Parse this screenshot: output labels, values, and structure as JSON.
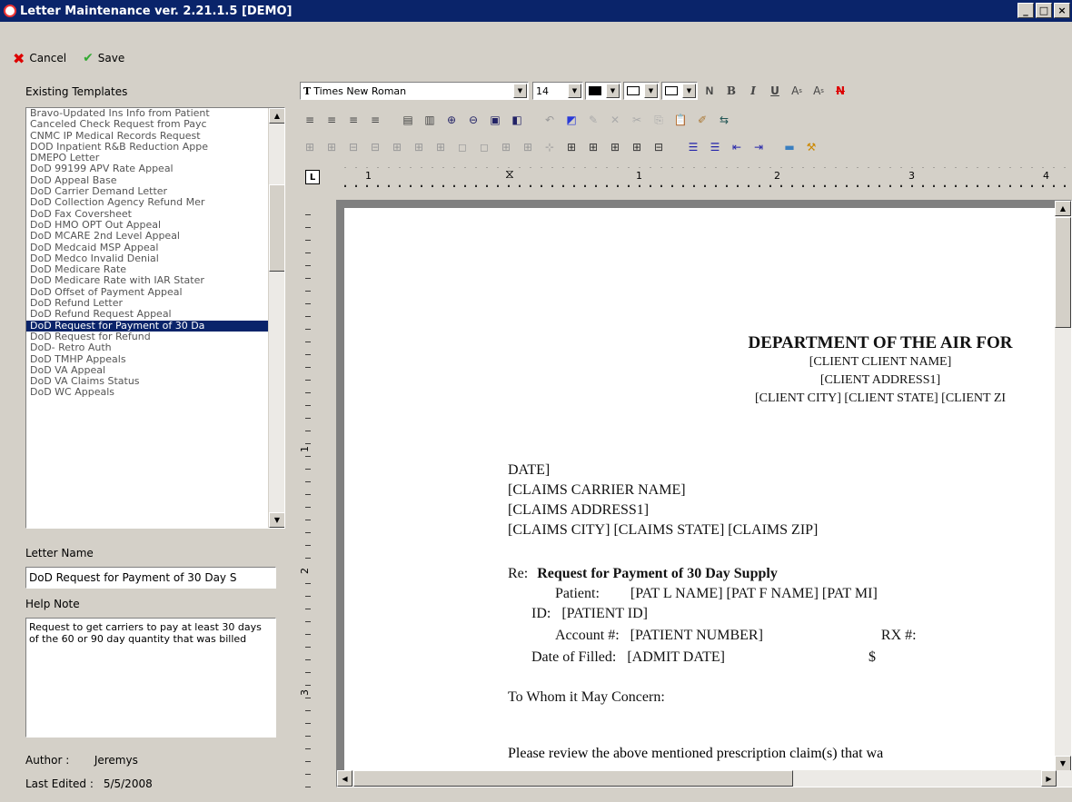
{
  "window": {
    "title": "Letter Maintenance ver. 2.21.1.5 [DEMO]",
    "min_glyph": "_",
    "max_glyph": "□",
    "close_glyph": "×"
  },
  "commands": {
    "cancel_label": "Cancel",
    "save_label": "Save"
  },
  "left": {
    "existing_templates_label": "Existing Templates",
    "templates": [
      "Bravo-Updated Ins Info from Patient",
      "Canceled Check Request from Payc",
      "CNMC IP Medical Records Request",
      "DOD Inpatient R&B Reduction Appe",
      "DMEPO Letter",
      "DoD 99199 APV Rate Appeal",
      "DoD Appeal Base",
      "DoD Carrier Demand Letter",
      "DoD Collection Agency Refund Mer",
      "DoD Fax Coversheet",
      "DoD HMO OPT Out Appeal",
      "DoD MCARE 2nd Level Appeal",
      "DoD Medcaid MSP Appeal",
      "DoD Medco Invalid Denial",
      "DoD Medicare Rate",
      "DoD Medicare Rate with IAR Stater",
      "DoD Offset of Payment Appeal",
      "DoD Refund Letter",
      "DoD Refund Request Appeal",
      "DoD Request for Payment of 30 Da",
      "DoD Request for Refund",
      "DoD- Retro Auth",
      "DoD TMHP Appeals",
      "DoD VA Appeal",
      "DoD VA Claims Status",
      "DoD WC Appeals"
    ],
    "selected_index": 19,
    "letter_name_label": "Letter Name",
    "letter_name_value": "DoD Request for Payment of 30 Day S",
    "help_note_label": "Help Note",
    "help_note_value": "Request to get carriers to pay at least 30 days of the 60 or 90 day quantity that was billed",
    "author_label": "Author :",
    "author_value": "Jeremys",
    "last_edited_label": "Last Edited :",
    "last_edited_value": "5/5/2008"
  },
  "toolbar": {
    "font_name": "Times New Roman",
    "font_size": "14",
    "format_n": "N",
    "format_b": "B",
    "format_i": "I",
    "format_u": "U",
    "superscript": "A",
    "superscript_mark": "s",
    "subscript": "A",
    "subscript_mark": "s",
    "strike": "N"
  },
  "ruler": {
    "marks": [
      "1",
      "1",
      "2",
      "3",
      "4"
    ],
    "vmarks": [
      "1",
      "2",
      "3"
    ]
  },
  "document": {
    "org_title": "DEPARTMENT OF THE AIR FOR",
    "client_name": "[CLIENT CLIENT NAME]",
    "client_address": "[CLIENT ADDRESS1]",
    "client_city": "[CLIENT CITY] [CLIENT STATE] [CLIENT ZI",
    "date_line": "DATE]",
    "carrier_name": "[CLAIMS CARRIER NAME]",
    "claims_address": "[CLAIMS ADDRESS1]",
    "claims_city": "[CLAIMS CITY] [CLAIMS STATE] [CLAIMS ZIP]",
    "re_label": "Re:",
    "re_subject": "Request for Payment of 30 Day Supply",
    "patient_label": "Patient:",
    "patient_value": "[PAT L NAME] [PAT F NAME] [PAT MI]",
    "id_label": "ID:",
    "id_value": "[PATIENT ID]",
    "account_label": "Account #:",
    "account_value": "[PATIENT NUMBER]",
    "rx_label": "RX #:",
    "date_filled_label": "Date of Filled:",
    "date_filled_value": "[ADMIT DATE]",
    "dollar": "$",
    "salutation": "To Whom it May Concern:",
    "body_start": "Please review the above mentioned prescription claim(s) that wa"
  }
}
